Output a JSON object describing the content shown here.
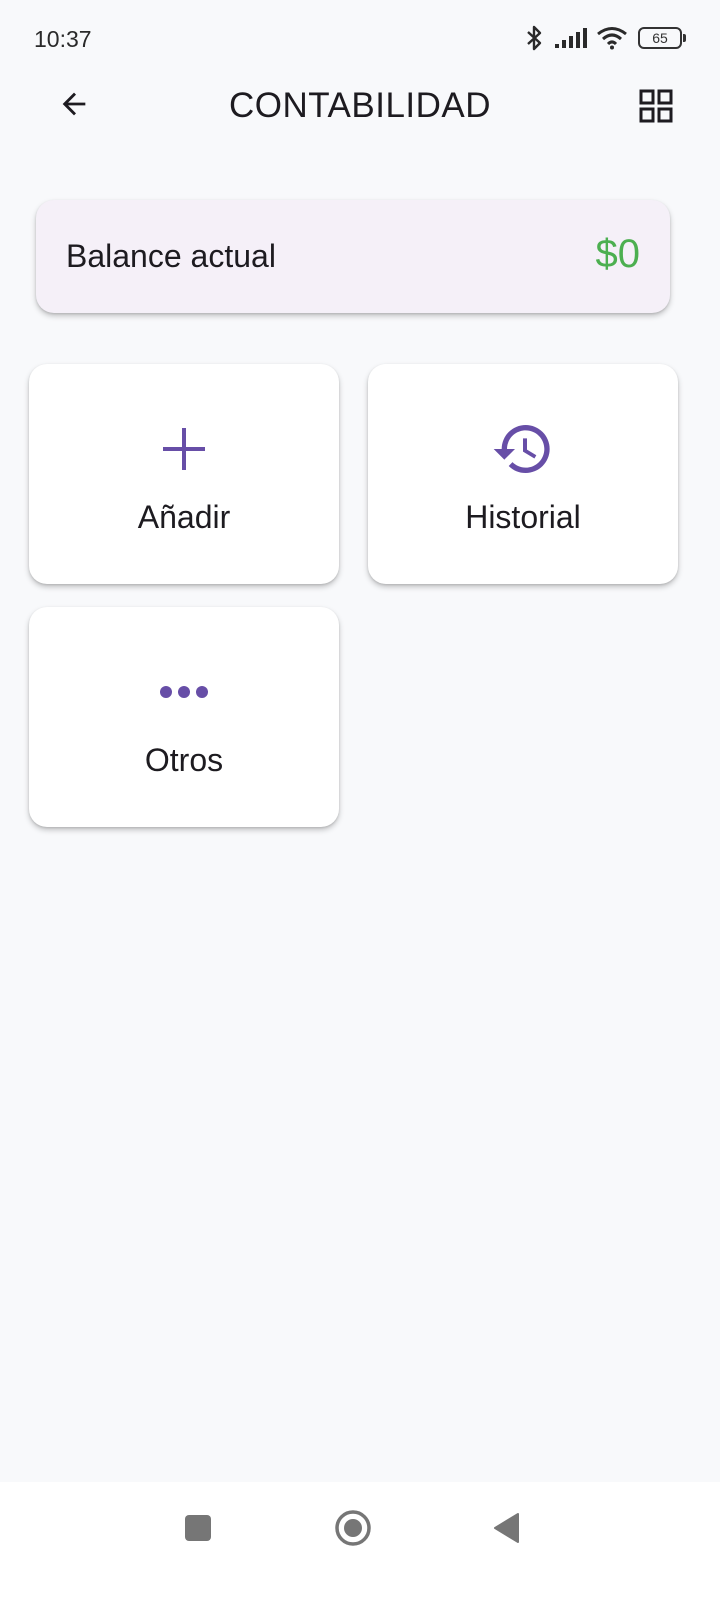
{
  "status_bar": {
    "time": "10:37",
    "battery": "65",
    "icons": [
      "bluetooth-icon",
      "signal-icon",
      "wifi-icon",
      "battery-icon"
    ]
  },
  "app_bar": {
    "title": "CONTABILIDAD",
    "back_icon": "arrow-back-icon",
    "menu_icon": "grid-view-icon"
  },
  "balance": {
    "label": "Balance actual",
    "value": "$0",
    "value_color": "#4caf50"
  },
  "tiles": [
    {
      "label": "Añadir",
      "icon": "add-icon"
    },
    {
      "label": "Historial",
      "icon": "history-icon"
    },
    {
      "label": "Otros",
      "icon": "more-horiz-icon"
    }
  ],
  "nav_bar": {
    "icons": [
      "recents-icon",
      "home-icon",
      "back-icon"
    ]
  },
  "colors": {
    "accent": "#674ea7",
    "background": "#f8f9fb",
    "card_tint": "#f5f0f8"
  }
}
